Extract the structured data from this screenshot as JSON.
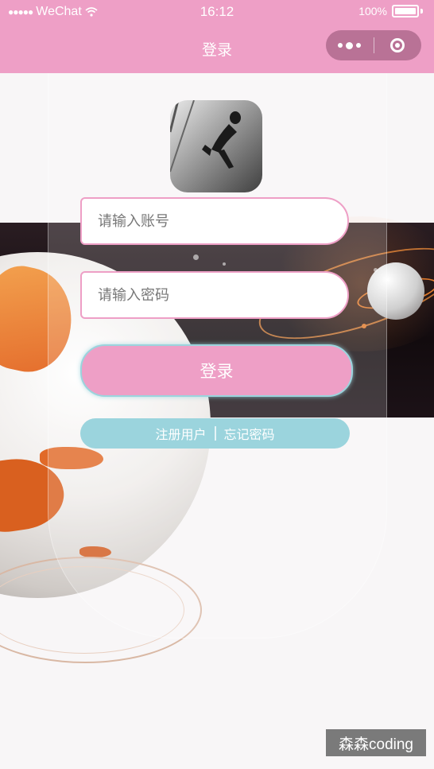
{
  "status_bar": {
    "carrier": "WeChat",
    "time": "16:12",
    "battery": "100%"
  },
  "nav": {
    "title": "登录"
  },
  "form": {
    "account_placeholder": "请输入账号",
    "password_placeholder": "请输入密码",
    "login_label": "登录",
    "register_link": "注册用户",
    "forgot_link": "忘记密码"
  },
  "watermark": "森森coding",
  "colors": {
    "accent_pink": "#ee9fc6",
    "accent_cyan": "#9bd4dd"
  }
}
